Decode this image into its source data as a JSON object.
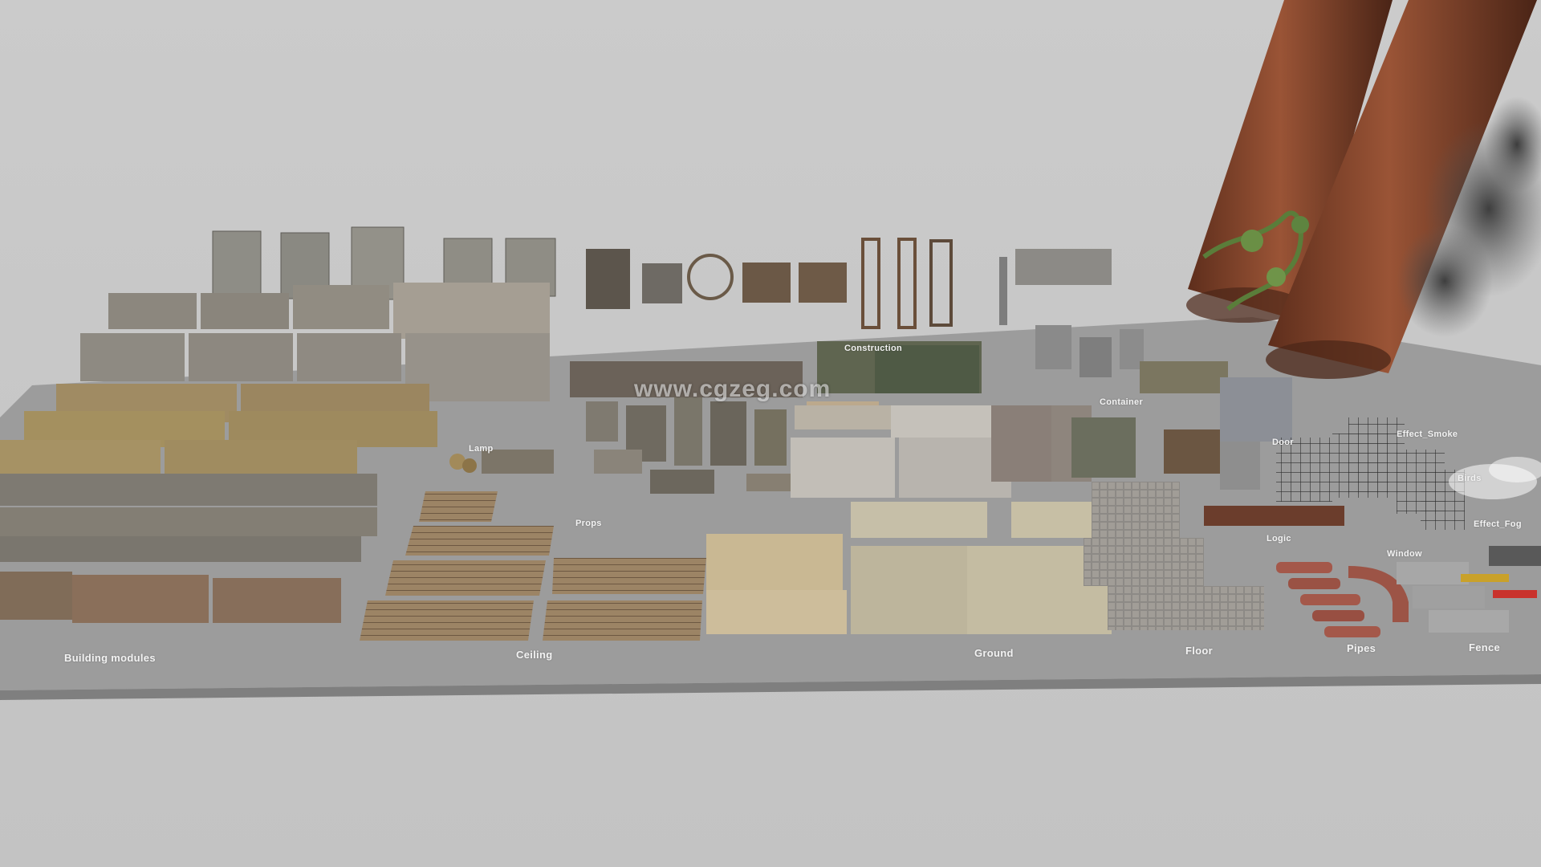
{
  "colors": {
    "background": "#c7c7c7",
    "floor_plate": "#9a9a9a",
    "brick": "#8a4a30",
    "smoke": "#3a3a3a"
  },
  "watermark": "www.cgzeg.com",
  "labels": {
    "building_modules": "Building modules",
    "ceiling": "Ceiling",
    "ground": "Ground",
    "floor": "Floor",
    "pipes": "Pipes",
    "fence": "Fence",
    "props": "Props",
    "construction": "Construction",
    "container": "Container",
    "logic": "Logic",
    "window": "Window",
    "effect_fog": "Effect_Fog",
    "birds": "Birds",
    "effect_smoke": "Effect_Smoke",
    "door": "Door",
    "lamp": "Lamp"
  }
}
